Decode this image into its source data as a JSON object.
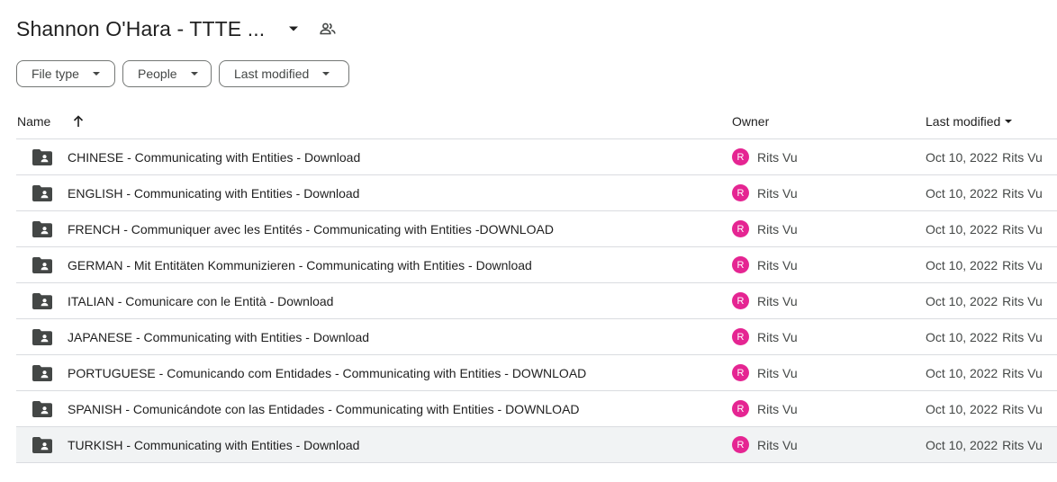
{
  "header": {
    "title": "Shannon O'Hara - TTTE ...",
    "caret_icon": "arrow-drop-down-icon",
    "shared_icon": "people-icon"
  },
  "filters": [
    {
      "label": "File type",
      "icon": "arrow-drop-down-icon"
    },
    {
      "label": "People",
      "icon": "arrow-drop-down-icon"
    },
    {
      "label": "Last modified",
      "icon": "arrow-drop-down-icon"
    }
  ],
  "table": {
    "columns": {
      "name": "Name",
      "owner": "Owner",
      "modified": "Last modified"
    },
    "sort_icon": "arrow-upward-icon",
    "rows": [
      {
        "name": "CHINESE - Communicating with Entities - Download",
        "owner": "Rits Vu",
        "avatar": "R",
        "date": "Oct 10, 2022",
        "by": "Rits Vu",
        "selected": false
      },
      {
        "name": "ENGLISH - Communicating with Entities - Download",
        "owner": "Rits Vu",
        "avatar": "R",
        "date": "Oct 10, 2022",
        "by": "Rits Vu",
        "selected": false
      },
      {
        "name": "FRENCH - Communiquer avec les Entités - Communicating with Entities -DOWNLOAD",
        "owner": "Rits Vu",
        "avatar": "R",
        "date": "Oct 10, 2022",
        "by": "Rits Vu",
        "selected": false
      },
      {
        "name": "GERMAN - Mit Entitäten Kommunizieren - Communicating with Entities - Download",
        "owner": "Rits Vu",
        "avatar": "R",
        "date": "Oct 10, 2022",
        "by": "Rits Vu",
        "selected": false
      },
      {
        "name": "ITALIAN - Comunicare con le Entità - Download",
        "owner": "Rits Vu",
        "avatar": "R",
        "date": "Oct 10, 2022",
        "by": "Rits Vu",
        "selected": false
      },
      {
        "name": "JAPANESE - Communicating with Entities - Download",
        "owner": "Rits Vu",
        "avatar": "R",
        "date": "Oct 10, 2022",
        "by": "Rits Vu",
        "selected": false
      },
      {
        "name": "PORTUGUESE - Comunicando com Entidades - Communicating with Entities - DOWNLOAD",
        "owner": "Rits Vu",
        "avatar": "R",
        "date": "Oct 10, 2022",
        "by": "Rits Vu",
        "selected": false
      },
      {
        "name": "SPANISH - Comunicándote con las Entidades - Communicating with Entities - DOWNLOAD",
        "owner": "Rits Vu",
        "avatar": "R",
        "date": "Oct 10, 2022",
        "by": "Rits Vu",
        "selected": false
      },
      {
        "name": "TURKISH - Communicating with Entities - Download",
        "owner": "Rits Vu",
        "avatar": "R",
        "date": "Oct 10, 2022",
        "by": "Rits Vu",
        "selected": true
      }
    ]
  },
  "colors": {
    "avatar": "#e52592",
    "folder": "#444746",
    "selected_row": "#f1f3f4"
  }
}
